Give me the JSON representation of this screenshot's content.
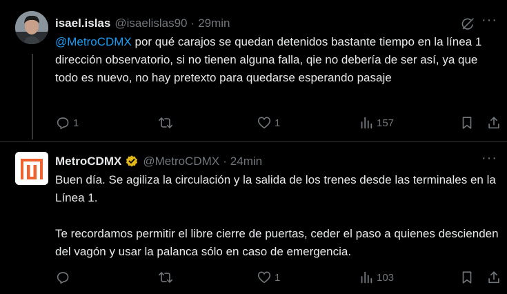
{
  "tweets": [
    {
      "display_name": "isael.islas",
      "handle": "@isaelislas90",
      "separator": "·",
      "time": "29min",
      "mention": "@MetroCDMX",
      "text": " por qué carajos se quedan detenidos bastante tiempo en la línea 1 dirección observatorio, si no tienen alguna falla, qie no debería de ser así, ya que todo es nuevo, no hay pretexto para quedarse esperando pasaje",
      "stats": {
        "replies": "1",
        "reposts": "",
        "likes": "1",
        "views": "157"
      },
      "icons": [
        "grok-icon",
        "more-icon",
        "reply-icon",
        "repost-icon",
        "like-icon",
        "views-icon",
        "bookmark-icon",
        "share-icon"
      ]
    },
    {
      "display_name": "MetroCDMX",
      "handle": "@MetroCDMX",
      "separator": "·",
      "time": "24min",
      "verified": true,
      "text": "Buen día. Se agiliza la circulación y la salida de los trenes desde las terminales en la Línea 1.\n\nTe recordamos permitir el libre cierre de puertas, ceder el paso a quienes descienden del vagón y usar la palanca sólo en caso de emergencia.",
      "stats": {
        "replies": "",
        "reposts": "",
        "likes": "1",
        "views": "103"
      },
      "icons": [
        "verified-badge-icon",
        "more-icon",
        "reply-icon",
        "repost-icon",
        "like-icon",
        "views-icon",
        "bookmark-icon",
        "share-icon"
      ]
    }
  ],
  "colors": {
    "background": "#000000",
    "text": "#e7e9ea",
    "secondary": "#71767b",
    "link": "#1d9bf0",
    "verified_gold": "#e2b719",
    "metro_orange": "#f0622d"
  }
}
